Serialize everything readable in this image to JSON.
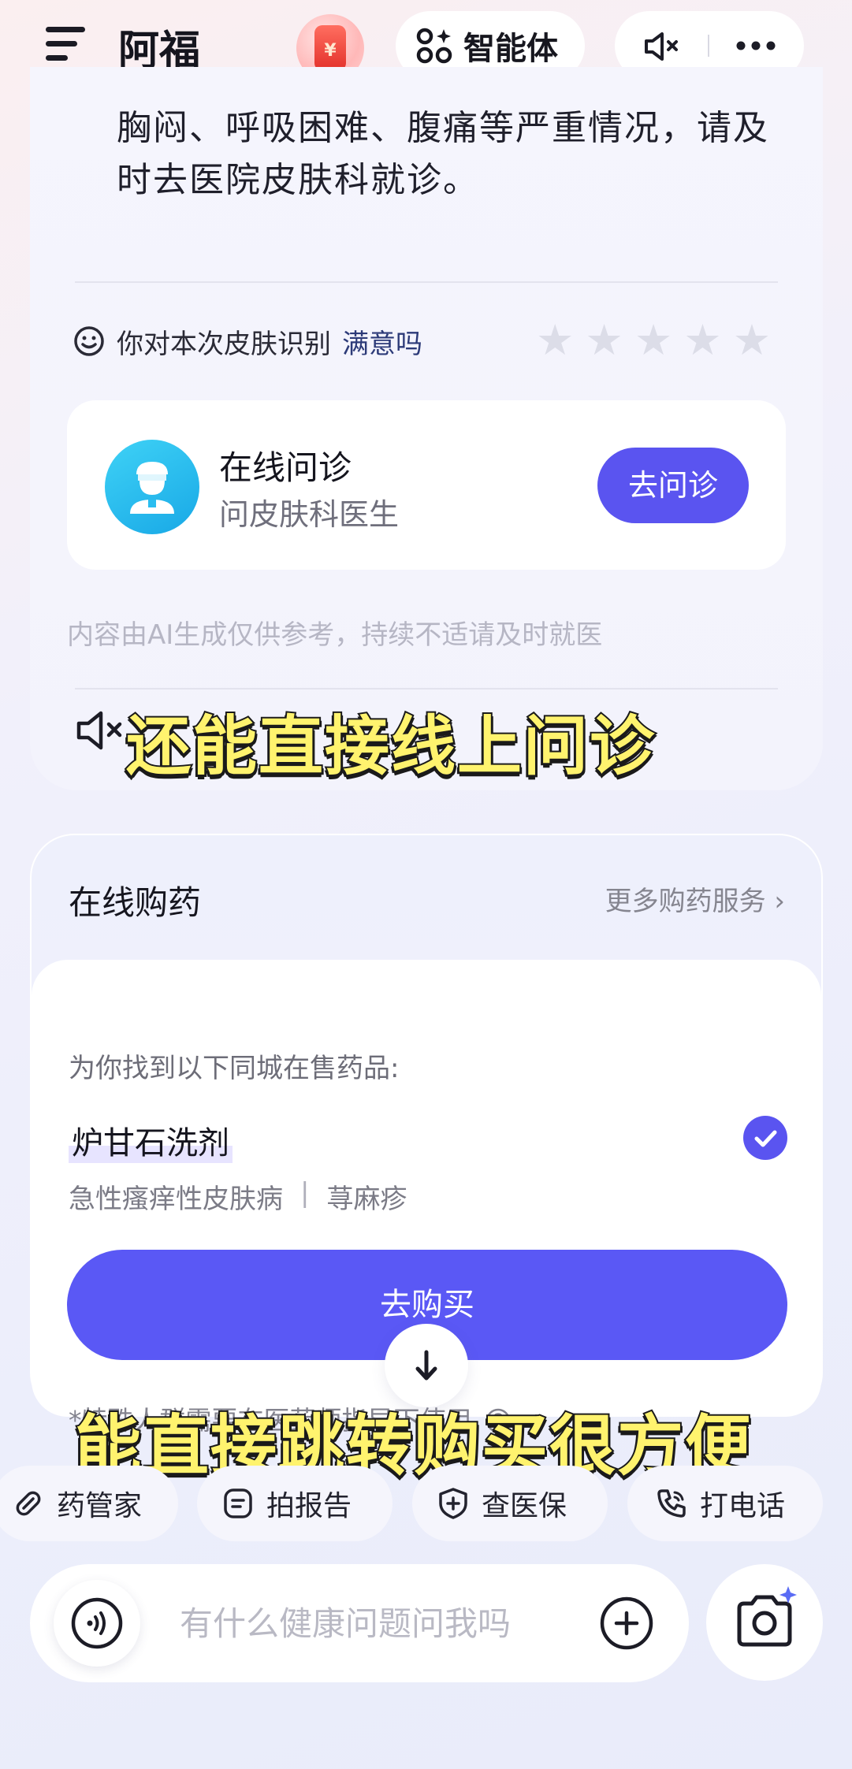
{
  "header": {
    "app_title": "阿福",
    "coin_symbol": "¥",
    "agent_button_label": "智能体",
    "icons": [
      "menu-icon",
      "coin-icon",
      "agent-icon",
      "speaker-mute-icon",
      "more-icon"
    ]
  },
  "chat": {
    "warning_text": "胸闷、呼吸困难、腹痛等严重情况，请及时去医院皮肤科就诊。",
    "feedback": {
      "question": "你对本次皮肤识别",
      "highlight": "满意吗",
      "stars_total": 5,
      "stars_selected": 0
    },
    "consult_card": {
      "title": "在线问诊",
      "subtitle": "问皮肤科医生",
      "button_label": "去问诊"
    },
    "ai_disclaimer": "内容由AI生成仅供参考，持续不适请及时就医"
  },
  "captions": {
    "caption1": "还能直接线上问诊",
    "caption2": "能直接跳转购买很方便"
  },
  "pharmacy": {
    "title": "在线购药",
    "more_label": "更多购药服务 ›",
    "found_text": "为你找到以下同城在售药品:",
    "drug": {
      "name": "炉甘石洗剂",
      "checked": true,
      "tags": [
        "急性瘙痒性皮肤病",
        "荨麻疹"
      ],
      "tag_separator": "|"
    },
    "buy_button_label": "去购买",
    "footnote": "*特殊人群需要在医药师指导下使用"
  },
  "quick_actions": [
    {
      "label": "药管家",
      "icon": "pill-icon"
    },
    {
      "label": "拍报告",
      "icon": "report-icon"
    },
    {
      "label": "查医保",
      "icon": "insurance-icon"
    },
    {
      "label": "打电话",
      "icon": "phone-icon"
    }
  ],
  "input": {
    "placeholder": "有什么健康问题问我吗"
  },
  "colors": {
    "accent": "#5a54f0",
    "caption_yellow": "#fff36e",
    "consult_avatar": "#29bdf0"
  }
}
